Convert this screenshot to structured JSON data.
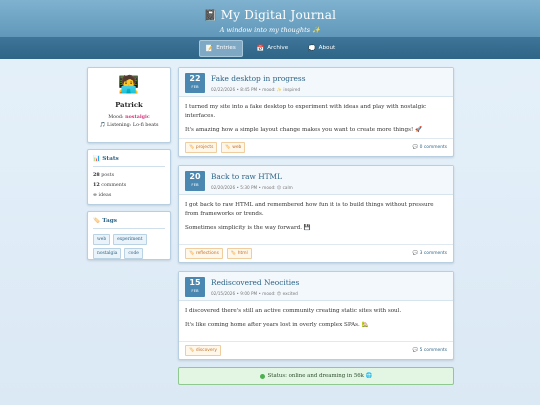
{
  "header": {
    "icon": "📓",
    "title": "My Digital Journal",
    "tagline": "A window into my thoughts ✨"
  },
  "nav": [
    {
      "icon": "📝",
      "label": "Entries",
      "active": true
    },
    {
      "icon": "📅",
      "label": "Archive",
      "active": false
    },
    {
      "icon": "💭",
      "label": "About",
      "active": false
    }
  ],
  "profile": {
    "avatar": "🧑‍💻",
    "name": "Patrick",
    "mood_label": "Mood:",
    "mood_value": "nostalgic",
    "listening": "🎵 Listening: Lo-fi beats"
  },
  "stats": {
    "title": "📊 Stats",
    "posts_value": "28",
    "posts_label": "posts",
    "comments_value": "12",
    "comments_label": "comments",
    "ideas_value": "∞",
    "ideas_label": "ideas"
  },
  "tags": {
    "title": "🏷️ Tags",
    "items": [
      "web",
      "experiment",
      "nostalgia",
      "code"
    ]
  },
  "entries": [
    {
      "day": "22",
      "month": "FEB",
      "title": "Fake desktop in progress",
      "meta": "02/22/2026 • 8:45 PM • mood: ✨ inspired",
      "paragraphs": [
        "I turned my site into a fake desktop to experiment with ideas and play with nostalgic interfaces.",
        "It's amazing how a simple layout change makes you want to create more things! 🚀"
      ],
      "tags": [
        "🏷️ projects",
        "🏷️ web"
      ],
      "comments": "💬 0 comments"
    },
    {
      "day": "20",
      "month": "FEB",
      "title": "Back to raw HTML",
      "meta": "02/20/2026 • 5:30 PM • mood: 😌 calm",
      "paragraphs": [
        "I got back to raw HTML and remembered how fun it is to build things without pressure from frameworks or trends.",
        "Sometimes simplicity is the way forward. 💾"
      ],
      "tags": [
        "🏷️ reflections",
        "🏷️ html"
      ],
      "comments": "💬 3 comments"
    },
    {
      "day": "15",
      "month": "FEB",
      "title": "Rediscovered Neocities",
      "meta": "02/15/2026 • 9:00 PM • mood: 😍 excited",
      "paragraphs": [
        "I discovered there's still an active community creating static sites with soul.",
        "It's like coming home after years lost in overly complex SPAs. 🏡"
      ],
      "tags": [
        "🏷️ discovery"
      ],
      "comments": "💬 5 comments"
    }
  ],
  "status": "Status: online and dreaming in 56k 🌐",
  "colors": {
    "accent": "#2f6587",
    "header": "#4f88ad",
    "date_box": "#4a88b1",
    "mood": "#d0357b",
    "status_bg": "#e3f6e3"
  }
}
